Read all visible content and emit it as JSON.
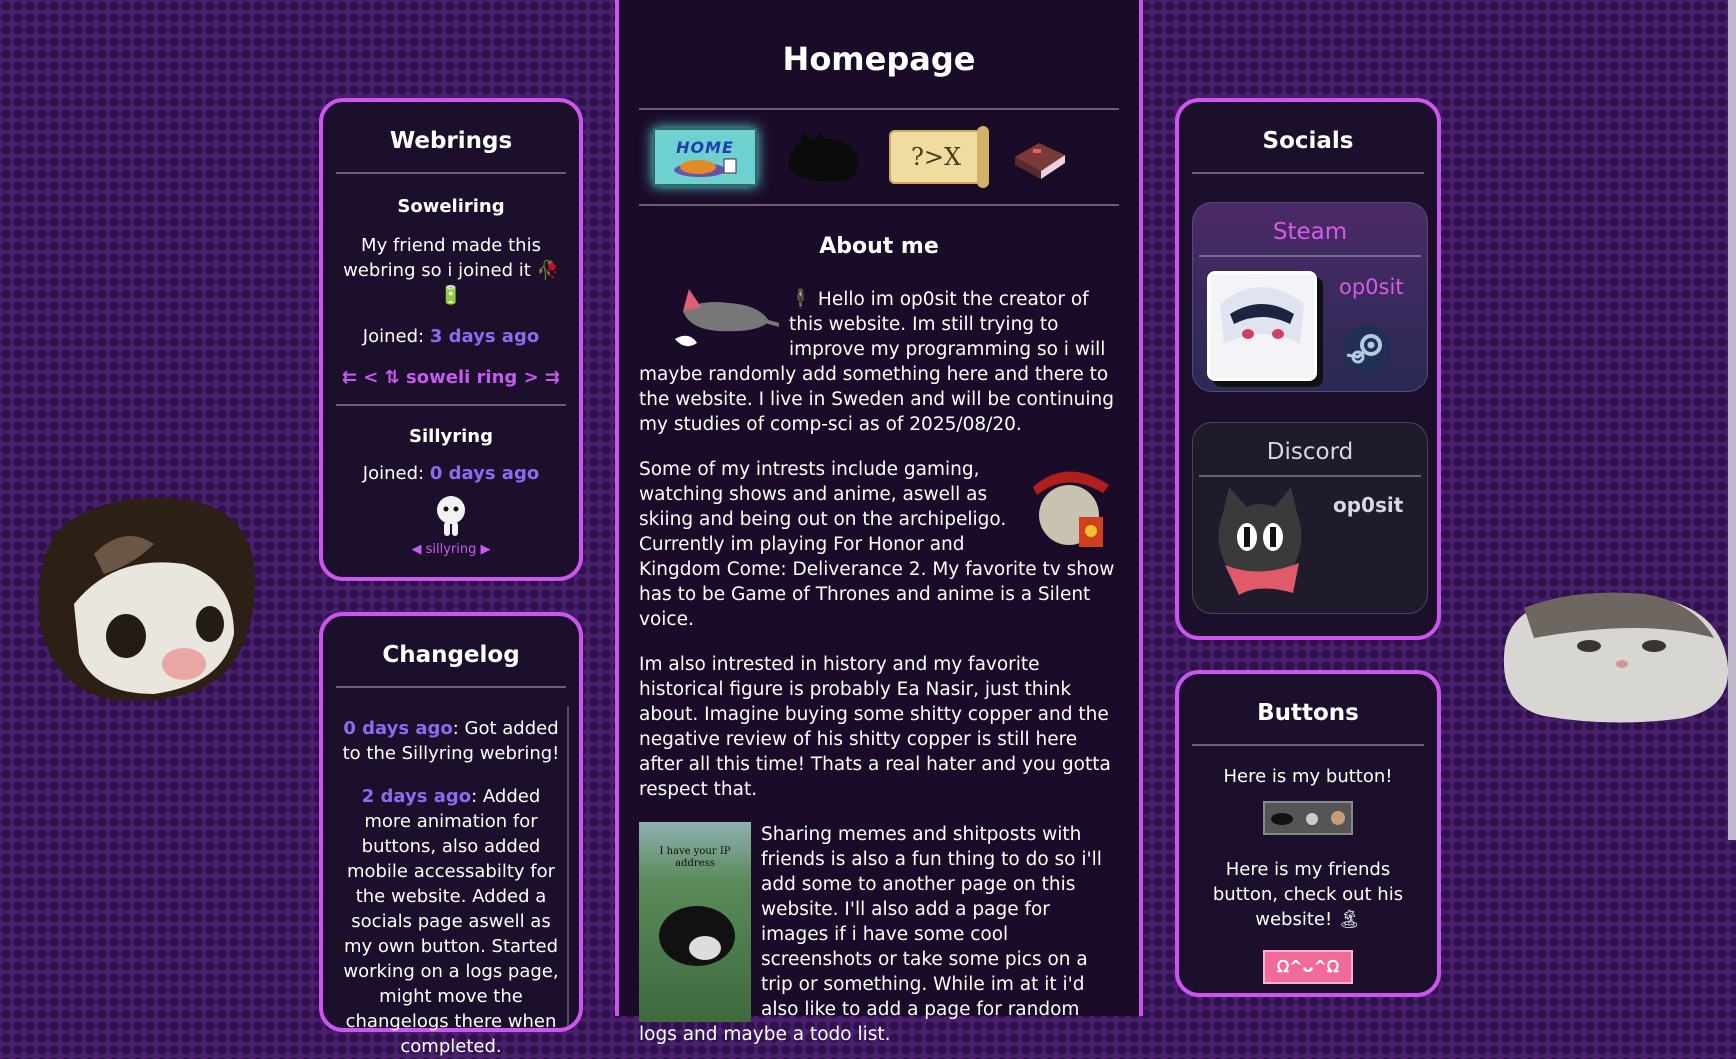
{
  "page": {
    "title": "Homepage"
  },
  "nav": {
    "home_label": "HOME",
    "scroll_label": "?>X"
  },
  "about": {
    "heading": "About me",
    "p1": "🕴 Hello im op0sit the creator of this website. Im still trying to improve my programming so i will maybe randomly add something here and there to the website. I live in Sweden and will be continuing my studies of comp-sci as of 2025/08/20.",
    "p2": "Some of my intrests include gaming, watching shows and anime, aswell as skiing and being out on the archipeligo. Currently im playing For Honor and Kingdom Come: Deliverance 2. My favorite tv show has to be Game of Thrones and anime is a Silent voice.",
    "p3": "Im also intrested in history and my favorite historical figure is probably Ea Nasir, just think about. Imagine buying some shitty copper and the negative review of his shitty copper is still here after all this time! Thats a real hater and you gotta respect that.",
    "p4": "Sharing memes and shitposts with friends is also a fun thing to do so i'll add some to another page on this website. I'll also add a page for images if i have some cool screenshots or take some pics on a trip or something. While im at it i'd also like to add a page for random logs and maybe a todo list.",
    "meme_caption": "I have your IP address"
  },
  "webrings": {
    "heading": "Webrings",
    "soweli": {
      "name": "Soweliring",
      "desc": "My friend made this webring so i joined it 🥀 🔋",
      "joined_label": "Joined: ",
      "joined_value": "3 days ago",
      "nav_text": "⇇ < ⇅ soweli ring > ⇉"
    },
    "silly": {
      "name": "Sillyring",
      "joined_label": "Joined: ",
      "joined_value": "0 days ago",
      "nav_text": "◀ sillyring ▶"
    }
  },
  "changelog": {
    "heading": "Changelog",
    "entries": [
      {
        "when": "0 days ago",
        "text": ": Got added to the Sillyring webring!"
      },
      {
        "when": "2 days ago",
        "text": ": Added more animation for buttons, also added mobile accessabilty for the website. Added a socials page aswell as my own button. Started working on a logs page, might move the changelogs there when completed."
      }
    ]
  },
  "socials": {
    "heading": "Socials",
    "steam": {
      "title": "Steam",
      "username": "op0sit",
      "icon": "steam-icon"
    },
    "discord": {
      "title": "Discord",
      "username": "op0sit"
    }
  },
  "buttons": {
    "heading": "Buttons",
    "mine_label": "Here is my button!",
    "friend_label": "Here is my friends button, check out his website! 🏝",
    "friend_button_text": "ᘯ^ᴗ^ᘯ"
  },
  "colors": {
    "accent": "#cc55ee",
    "link": "#8a6cf0",
    "steam_title": "#d65be6"
  }
}
